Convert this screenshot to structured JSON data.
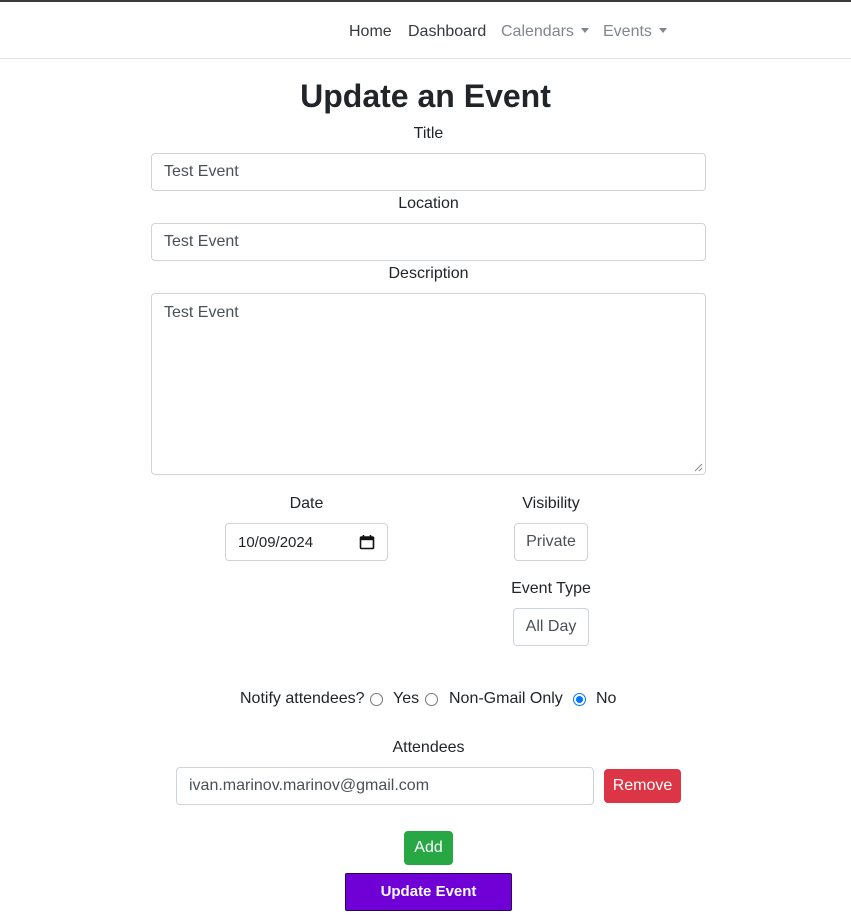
{
  "nav": {
    "home": "Home",
    "dashboard": "Dashboard",
    "calendars": "Calendars",
    "events": "Events"
  },
  "page_title": "Update an Event",
  "form": {
    "title_label": "Title",
    "title_value": "Test Event",
    "location_label": "Location",
    "location_value": "Test Event",
    "description_label": "Description",
    "description_value": "Test Event",
    "date_label": "Date",
    "date_value": "10/09/2024",
    "visibility_label": "Visibility",
    "visibility_value": "Private",
    "event_type_label": "Event Type",
    "event_type_value": "All Day",
    "notify_label": "Notify attendees?",
    "notify_options": [
      "Yes",
      "Non-Gmail Only",
      "No"
    ],
    "notify_selected": "No",
    "attendees_label": "Attendees",
    "attendees": [
      "ivan.marinov.marinov@gmail.com"
    ],
    "remove_label": "Remove",
    "add_label": "Add",
    "submit_label": "Update Event"
  },
  "colors": {
    "danger": "#dc3545",
    "success": "#28a745",
    "primary": "#6f00d6",
    "radio_checked": "#0075ff"
  },
  "icons": [
    "calendar-icon",
    "chevron-down-icon"
  ]
}
